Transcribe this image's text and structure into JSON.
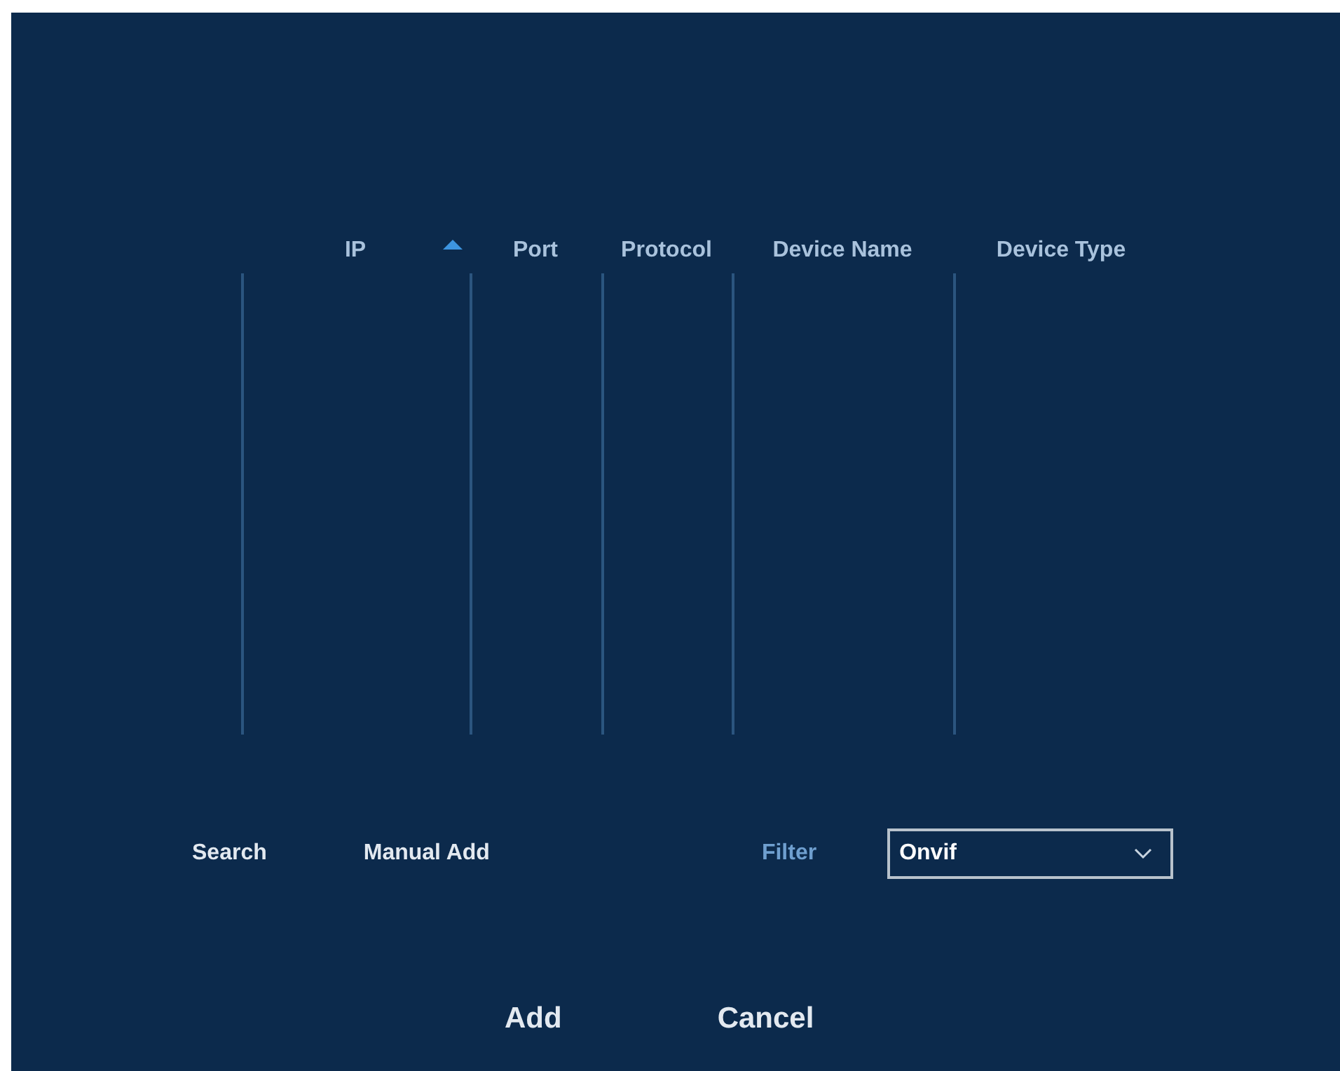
{
  "table": {
    "columns": [
      {
        "label": "IP",
        "sorted": true
      },
      {
        "label": "Port",
        "sorted": false
      },
      {
        "label": "Protocol",
        "sorted": false
      },
      {
        "label": "Device Name",
        "sorted": false
      },
      {
        "label": "Device Type",
        "sorted": false
      }
    ]
  },
  "actions": [
    {
      "label": "Search"
    },
    {
      "label": "Manual Add"
    }
  ],
  "filter": {
    "label": "Filter",
    "value": "Onvif"
  },
  "buttons": [
    {
      "label": "Add"
    },
    {
      "label": "Cancel"
    }
  ]
}
